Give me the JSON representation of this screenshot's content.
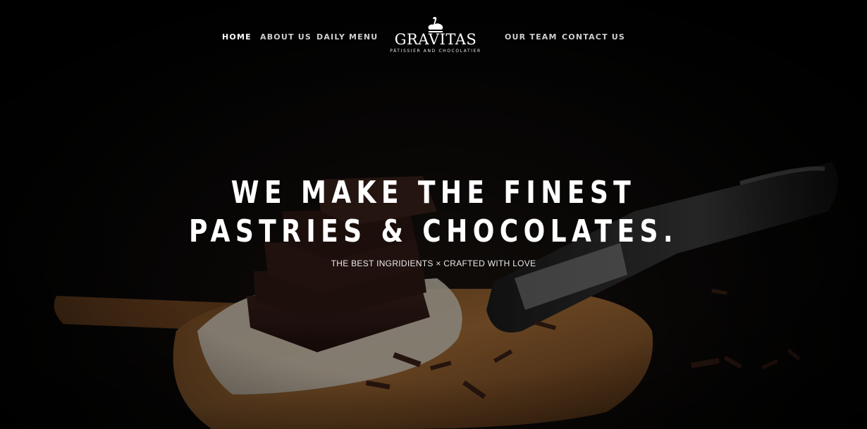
{
  "nav": {
    "left": [
      {
        "label": "HOME",
        "active": true
      },
      {
        "label": "ABOUT US"
      },
      {
        "label": "DAILY MENU"
      }
    ],
    "right": [
      {
        "label": "OUR TEAM"
      },
      {
        "label": "CONTACT US"
      }
    ]
  },
  "logo": {
    "wordmark": "GRAVITAS",
    "subtitle": "PÂTISSIER AND CHOCOLATIER",
    "icon": "swan-icon"
  },
  "hero": {
    "headline_line1": "WE MAKE THE FINEST",
    "headline_line2": "PASTRIES & CHOCOLATES.",
    "tagline": "THE BEST INGRIDIENTS × CRAFTED WITH LOVE",
    "background_image": "chocolate-on-cutting-board-photo"
  },
  "colors": {
    "background": "#050505",
    "text": "#ffffff",
    "nav_text": "#cfcfcf",
    "wood": "#8a5a2b",
    "chocolate": "#2a1612"
  }
}
